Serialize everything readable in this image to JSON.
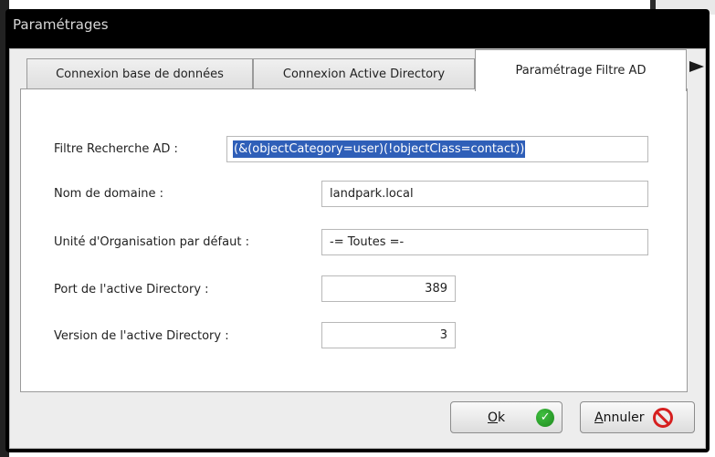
{
  "window": {
    "title": "Paramétrages"
  },
  "tabs": [
    {
      "label": "Connexion base de données",
      "active": false
    },
    {
      "label": "Connexion Active Directory",
      "active": false
    },
    {
      "label": "Paramétrage Filtre AD",
      "active": true
    }
  ],
  "form": {
    "filter": {
      "label": "Filtre Recherche AD :",
      "value": "(&(objectCategory=user)(!objectClass=contact))"
    },
    "domain": {
      "label": "Nom de domaine :",
      "value": "landpark.local"
    },
    "ou": {
      "label": "Unité d'Organisation par défaut :",
      "value": "-= Toutes =-"
    },
    "port": {
      "label": "Port de l'active Directory :",
      "value": "389"
    },
    "version": {
      "label": "Version de l'active Directory :",
      "value": "3"
    }
  },
  "buttons": {
    "ok": {
      "mnemonic": "O",
      "rest": "k"
    },
    "cancel": {
      "mnemonic": "A",
      "rest": "nnuler"
    }
  },
  "colors": {
    "selection": "#2f5fb8",
    "ok": "#2a9d2a",
    "cancel": "#d61f1f"
  }
}
